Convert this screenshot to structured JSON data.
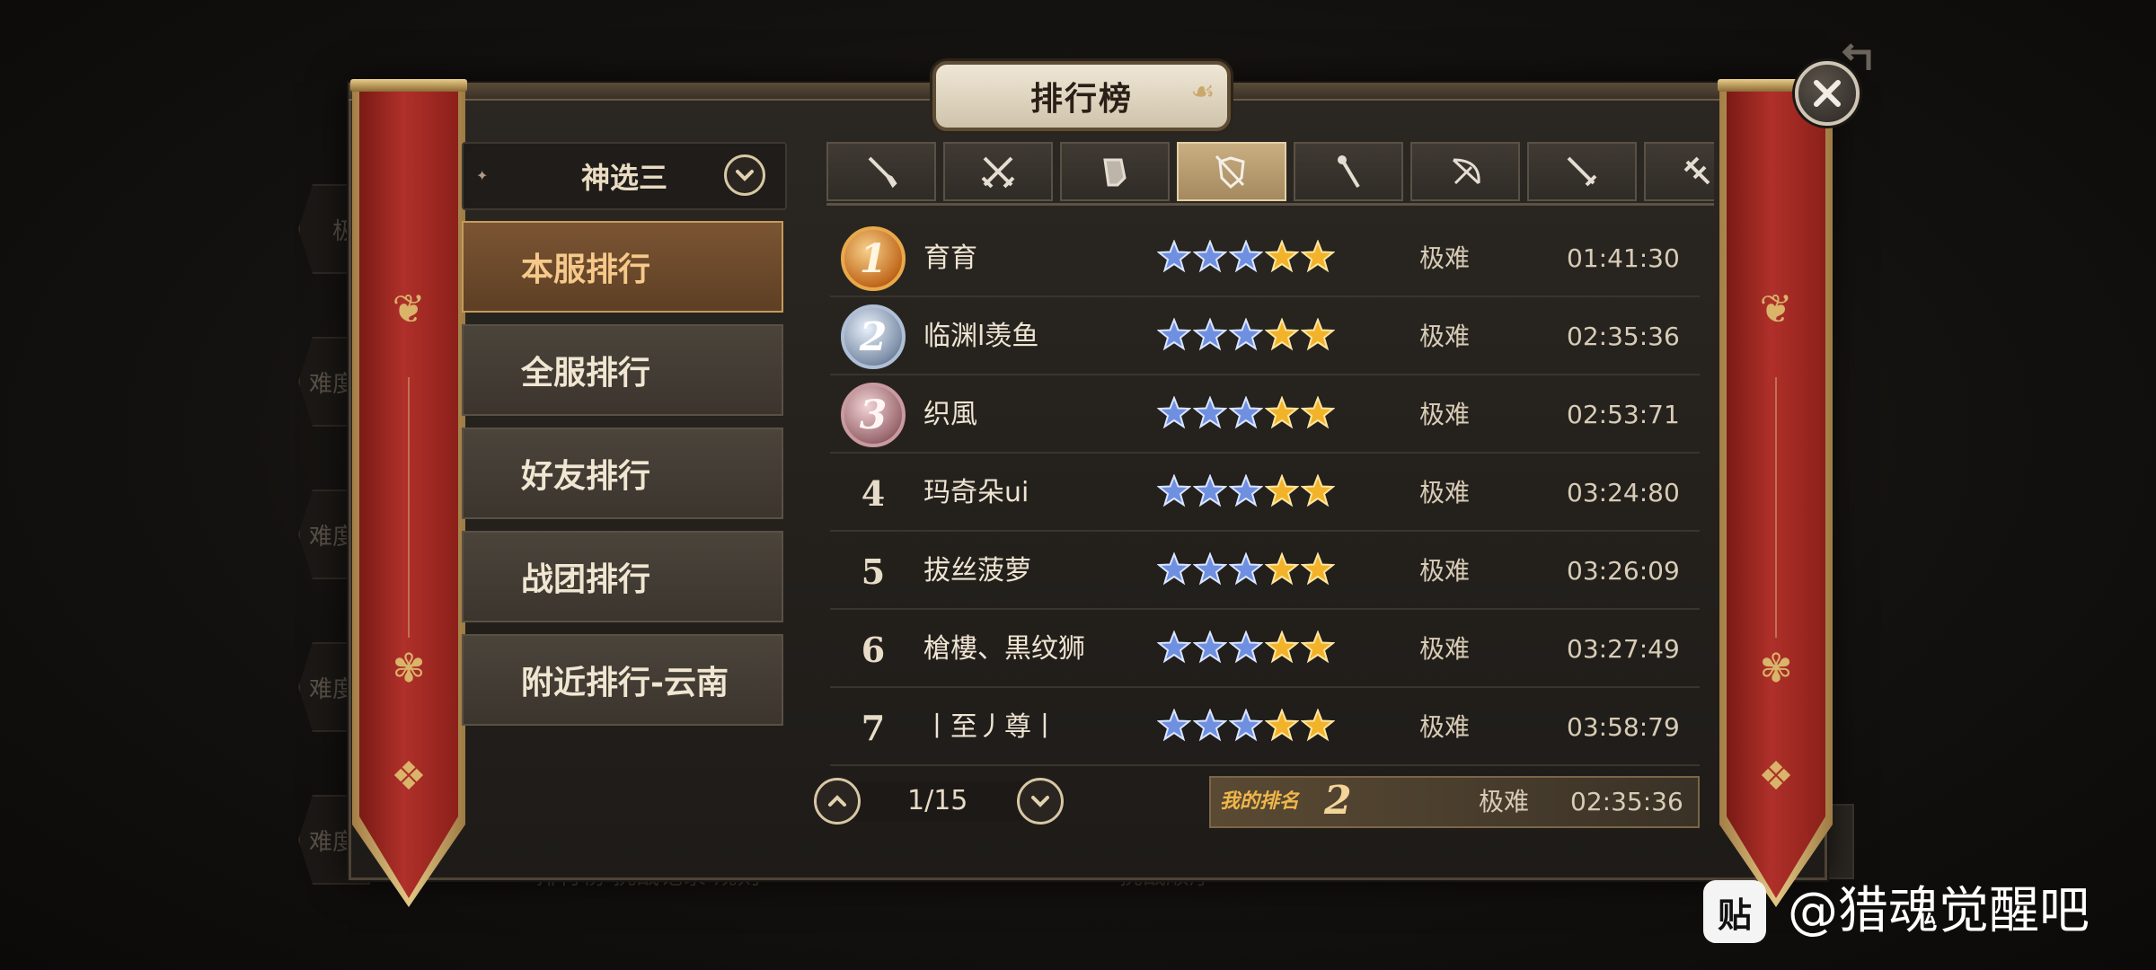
{
  "title": "排行榜",
  "difficulty_select": {
    "value": "神选三"
  },
  "menu": [
    {
      "label": "本服排行",
      "active": true
    },
    {
      "label": "全服排行",
      "active": false
    },
    {
      "label": "好友排行",
      "active": false
    },
    {
      "label": "战团排行",
      "active": false
    },
    {
      "label": "附近排行-云南",
      "active": false
    }
  ],
  "weapon_tabs": [
    {
      "icon": "dagger-icon",
      "active": false
    },
    {
      "icon": "dual-swords-icon",
      "active": false
    },
    {
      "icon": "gauntlet-icon",
      "active": false
    },
    {
      "icon": "shield-sword-icon",
      "active": true
    },
    {
      "icon": "staff-icon",
      "active": false
    },
    {
      "icon": "bow-icon",
      "active": false
    },
    {
      "icon": "longsword-icon",
      "active": false
    },
    {
      "icon": "crossbow-icon",
      "active": false
    }
  ],
  "rows": [
    {
      "rank": "1",
      "medal": "gold",
      "name": "育育",
      "stars_blue": 3,
      "stars_gold": 2,
      "difficulty": "极难",
      "time": "01:41:30"
    },
    {
      "rank": "2",
      "medal": "silver",
      "name": "临渊l羡鱼",
      "stars_blue": 3,
      "stars_gold": 2,
      "difficulty": "极难",
      "time": "02:35:36"
    },
    {
      "rank": "3",
      "medal": "bronze",
      "name": "织風",
      "stars_blue": 3,
      "stars_gold": 2,
      "difficulty": "极难",
      "time": "02:53:71"
    },
    {
      "rank": "4",
      "medal": "",
      "name": "玛奇朵ui",
      "stars_blue": 3,
      "stars_gold": 2,
      "difficulty": "极难",
      "time": "03:24:80"
    },
    {
      "rank": "5",
      "medal": "",
      "name": "拔丝菠萝",
      "stars_blue": 3,
      "stars_gold": 2,
      "difficulty": "极难",
      "time": "03:26:09"
    },
    {
      "rank": "6",
      "medal": "",
      "name": "槍樓、黒纹狮",
      "stars_blue": 3,
      "stars_gold": 2,
      "difficulty": "极难",
      "time": "03:27:49"
    },
    {
      "rank": "7",
      "medal": "",
      "name": "丨至丿尊丨",
      "stars_blue": 3,
      "stars_gold": 2,
      "difficulty": "极难",
      "time": "03:58:79"
    }
  ],
  "pagination": {
    "text": "1/15"
  },
  "my_rank": {
    "label": "我的排名",
    "rank": "2",
    "difficulty": "极难",
    "time": "02:35:36"
  },
  "background": {
    "side_tabs": [
      "极",
      "难度",
      "难度",
      "难度",
      "难度"
    ],
    "footer_left": "排行榜   挑战记录   规则",
    "footer_right": "挑战顺序"
  },
  "watermark": {
    "logo": "贴",
    "text": "@猎魂觉醒吧"
  },
  "colors": {
    "accent": "#c79a5b",
    "banner": "#b0302a",
    "star_blue": "#6f8fe0",
    "star_gold": "#f2b32a"
  }
}
